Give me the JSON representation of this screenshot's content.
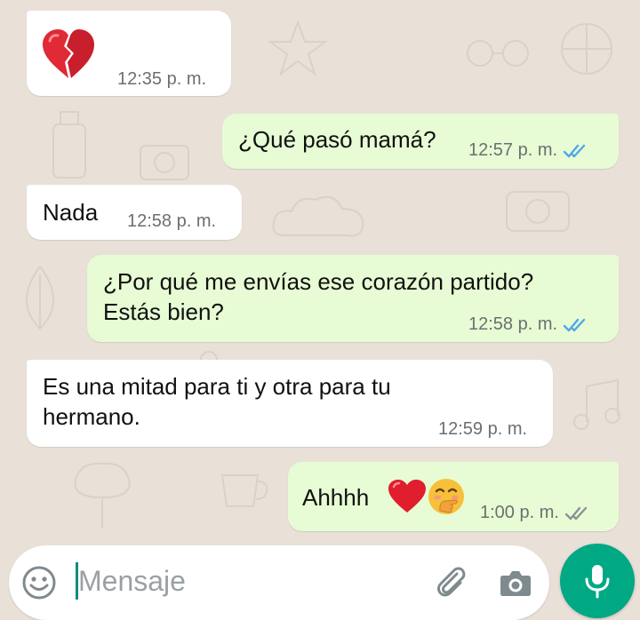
{
  "messages": [
    {
      "direction": "in",
      "text": "",
      "emoji": "broken-heart-icon",
      "time": "12:35 p. m."
    },
    {
      "direction": "out",
      "text": "¿Qué pasó mamá?",
      "time": "12:57 p. m.",
      "status": "read"
    },
    {
      "direction": "in",
      "text": "Nada",
      "time": "12:58 p. m."
    },
    {
      "direction": "out",
      "text": "¿Por qué me envías ese corazón partido?\nEstás bien?",
      "time": "12:58 p. m.",
      "status": "read"
    },
    {
      "direction": "in",
      "text": "Es una mitad para ti y otra para tu\nhermano.",
      "time": "12:59 p. m."
    },
    {
      "direction": "out",
      "text": "Ahhhh",
      "emojis": [
        "red-heart-icon",
        "hand-over-mouth-face-icon"
      ],
      "time": "1:00 p. m.",
      "status": "delivered"
    }
  ],
  "composer": {
    "placeholder": "Mensaje"
  },
  "colors": {
    "chat_background": "#e9e0d8",
    "incoming_bubble": "#ffffff",
    "outgoing_bubble": "#e7fcd4",
    "read_tick": "#4fa7e8",
    "delivered_tick": "#8a9296",
    "mic_button": "#00a884"
  }
}
